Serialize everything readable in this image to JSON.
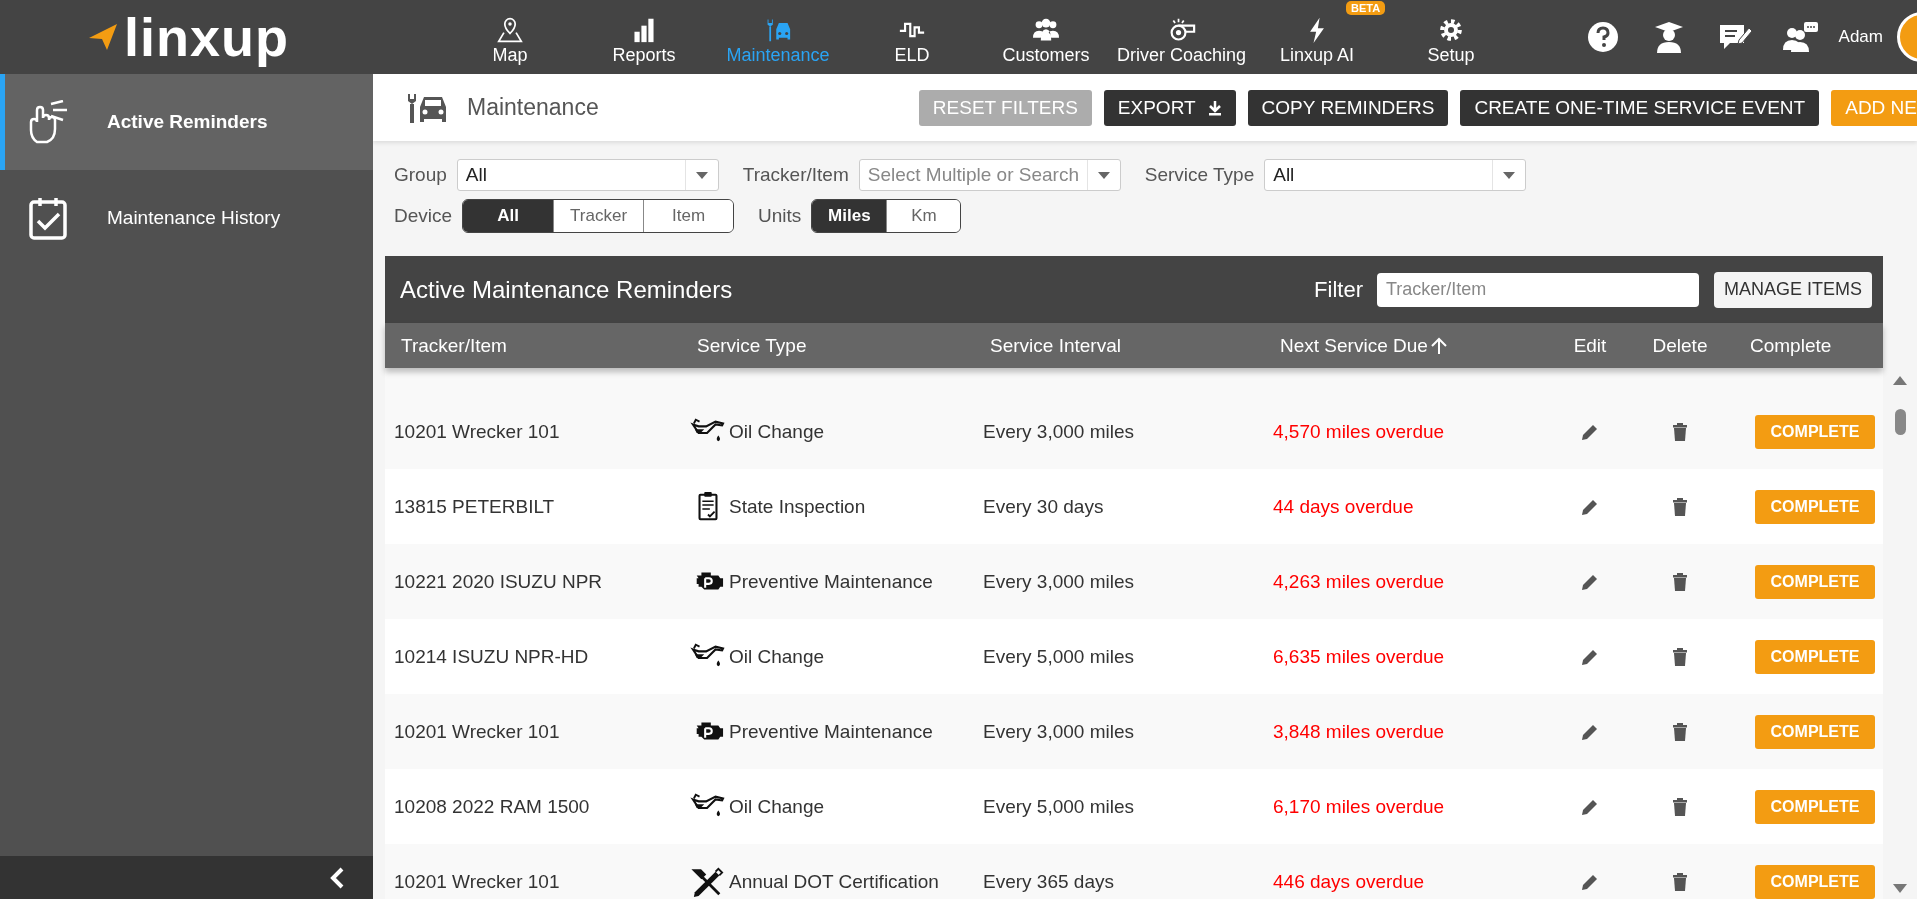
{
  "logo": "linxup",
  "nav": [
    {
      "label": "Map",
      "selected": false
    },
    {
      "label": "Reports",
      "selected": false
    },
    {
      "label": "Maintenance",
      "selected": true
    },
    {
      "label": "ELD",
      "selected": false
    },
    {
      "label": "Customers",
      "selected": false
    },
    {
      "label": "Driver Coaching",
      "selected": false
    },
    {
      "label": "Linxup AI",
      "selected": false,
      "badge": "BETA"
    },
    {
      "label": "Setup",
      "selected": false
    }
  ],
  "user": {
    "name": "Adam"
  },
  "sidebar": {
    "items": [
      {
        "label": "Active Reminders",
        "selected": true
      },
      {
        "label": "Maintenance History",
        "selected": false
      }
    ]
  },
  "page_title": "Maintenance",
  "actions": [
    {
      "label": "RESET FILTERS",
      "disabled": true,
      "kind": "plain"
    },
    {
      "label": "EXPORT",
      "disabled": false,
      "kind": "download"
    },
    {
      "label": "COPY REMINDERS",
      "disabled": false,
      "kind": "plain"
    },
    {
      "label": "CREATE ONE-TIME SERVICE EVENT",
      "disabled": false,
      "kind": "plain"
    },
    {
      "label": "ADD NE",
      "disabled": false,
      "kind": "primary"
    }
  ],
  "filters": {
    "selects": [
      {
        "label": "Group",
        "value": "All"
      },
      {
        "label": "Tracker/Item",
        "placeholder": "Select Multiple or Search"
      },
      {
        "label": "Service Type",
        "value": "All"
      }
    ],
    "toggles": [
      {
        "label": "Device",
        "options": [
          {
            "label": "All",
            "selected": true
          },
          {
            "label": "Tracker",
            "selected": false
          },
          {
            "label": "Item",
            "selected": false
          }
        ]
      },
      {
        "label": "Units",
        "options": [
          {
            "label": "Miles",
            "selected": true
          },
          {
            "label": "Km",
            "selected": false
          }
        ]
      }
    ]
  },
  "table": {
    "title": "Active Maintenance Reminders",
    "filter_label": "Filter",
    "filter_placeholder": "Tracker/Item",
    "manage_button": "MANAGE ITEMS",
    "columns": [
      {
        "label": "Tracker/Item",
        "sorted": false
      },
      {
        "label": "Service Type",
        "sorted": false
      },
      {
        "label": "Service Interval",
        "sorted": false
      },
      {
        "label": "Next Service Due",
        "sorted": true
      },
      {
        "label": "Edit",
        "sorted": false
      },
      {
        "label": "Delete",
        "sorted": false
      },
      {
        "label": "Complete",
        "sorted": false
      }
    ],
    "rows": [
      {
        "tracker": "10201 Wrecker 101",
        "kind": "oil",
        "service": "Oil Change",
        "interval": "Every 3,000 miles",
        "next_due": "4,570 miles overdue",
        "overdue": true,
        "action": "COMPLETE"
      },
      {
        "tracker": "13815 PETERBILT",
        "kind": "inspection",
        "service": "State Inspection",
        "interval": "Every 30 days",
        "next_due": "44 days overdue",
        "overdue": true,
        "action": "COMPLETE"
      },
      {
        "tracker": "10221 2020 ISUZU NPR",
        "kind": "engine",
        "service": "Preventive Maintenance",
        "interval": "Every 3,000 miles",
        "next_due": "4,263 miles overdue",
        "overdue": true,
        "action": "COMPLETE"
      },
      {
        "tracker": "10214 ISUZU NPR-HD",
        "kind": "oil",
        "service": "Oil Change",
        "interval": "Every 5,000 miles",
        "next_due": "6,635 miles overdue",
        "overdue": true,
        "action": "COMPLETE"
      },
      {
        "tracker": "10201 Wrecker 101",
        "kind": "engine",
        "service": "Preventive Maintenance",
        "interval": "Every 3,000 miles",
        "next_due": "3,848 miles overdue",
        "overdue": true,
        "action": "COMPLETE"
      },
      {
        "tracker": "10208 2022 RAM 1500",
        "kind": "oil",
        "service": "Oil Change",
        "interval": "Every 5,000 miles",
        "next_due": "6,170 miles overdue",
        "overdue": true,
        "action": "COMPLETE"
      },
      {
        "tracker": "10201 Wrecker 101",
        "kind": "dot",
        "service": "Annual DOT Certification",
        "interval": "Every 365 days",
        "next_due": "446 days overdue",
        "overdue": true,
        "action": "COMPLETE"
      }
    ]
  }
}
